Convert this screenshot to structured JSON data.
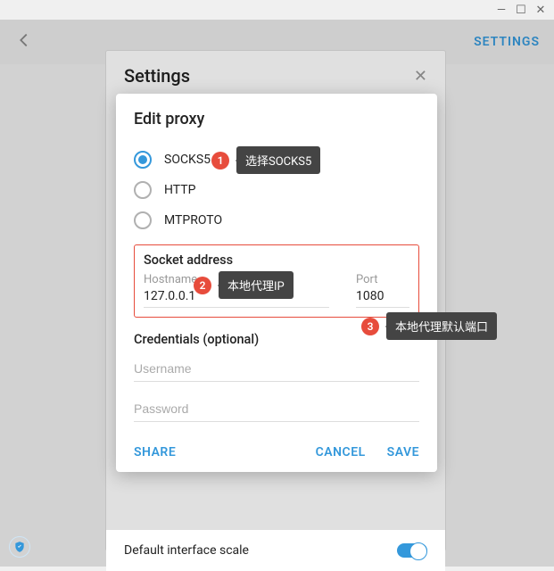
{
  "window": {
    "min": "—",
    "max": "☐",
    "close": "✕"
  },
  "header": {
    "settings_link": "SETTINGS"
  },
  "bg_panel": {
    "title": "Settings",
    "interface_scale_label": "Default interface scale"
  },
  "modal": {
    "title": "Edit proxy",
    "proxy_types": {
      "socks5": "SOCKS5",
      "http": "HTTP",
      "mtproto": "MTPROTO"
    },
    "socket_section_title": "Socket address",
    "hostname_label": "Hostname",
    "hostname_value": "127.0.0.1",
    "port_label": "Port",
    "port_value": "1080",
    "credentials_title": "Credentials (optional)",
    "username_placeholder": "Username",
    "password_placeholder": "Password",
    "share": "SHARE",
    "cancel": "CANCEL",
    "save": "SAVE"
  },
  "annotations": {
    "a1_num": "1",
    "a1_text": "选择SOCKS5",
    "a2_num": "2",
    "a2_text": "本地代理IP",
    "a3_num": "3",
    "a3_text": "本地代理默认端口"
  }
}
